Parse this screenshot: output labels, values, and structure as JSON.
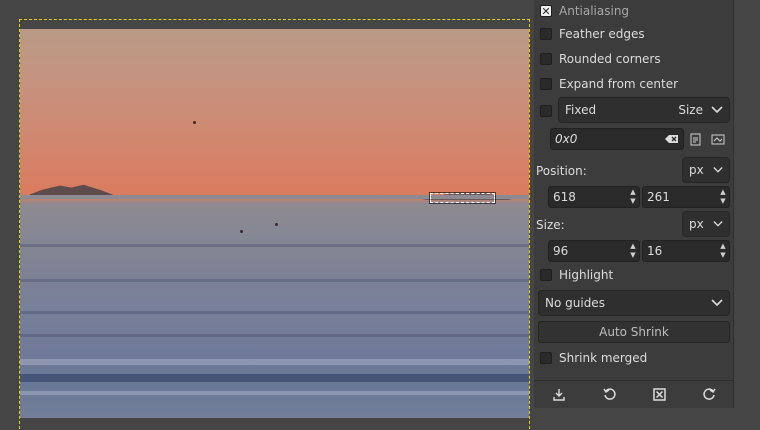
{
  "options": {
    "antialiasing": {
      "label": "Antialiasing",
      "checked": true
    },
    "feather_edges": {
      "label": "Feather edges",
      "checked": false
    },
    "rounded_corners": {
      "label": "Rounded corners",
      "checked": false
    },
    "expand_from_center": {
      "label": "Expand from center",
      "checked": false
    },
    "fixed": {
      "label": "Fixed",
      "mode": "Size",
      "checked": false
    },
    "ratio_value": "0x0",
    "highlight": {
      "label": "Highlight",
      "checked": false
    },
    "shrink_merged": {
      "label": "Shrink merged",
      "checked": false
    }
  },
  "position": {
    "label": "Position:",
    "unit": "px",
    "x": "618",
    "y": "261"
  },
  "size": {
    "label": "Size:",
    "unit": "px",
    "w": "96",
    "h": "16"
  },
  "guides": {
    "selected": "No guides"
  },
  "auto_shrink_label": "Auto Shrink",
  "icons": {
    "save": "save-preset-icon",
    "restore": "restore-icon",
    "delete": "delete-icon",
    "reset": "reset-icon"
  }
}
